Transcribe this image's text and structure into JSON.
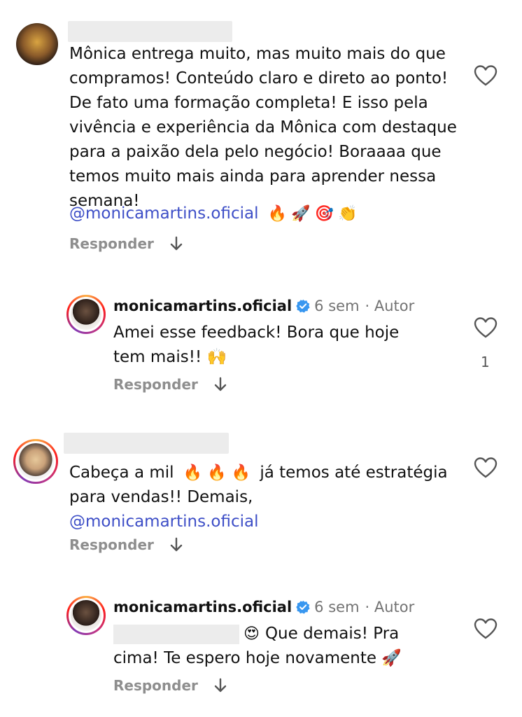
{
  "comments": [
    {
      "text": "Mônica entrega muito, mas muito mais do que compramos! Conteúdo claro e direto ao ponto! De fato uma formação completa! E isso pela vivência e experiência da Mônica com destaque para a paixão dela pelo negócio! Boraaaa que temos muito mais ainda para aprender nessa semana!",
      "mention": "@monicamartins.oficial",
      "emojis": "🔥🚀🎯👏",
      "reply_label": "Responder"
    },
    {
      "username": "monicamartins.oficial",
      "time": "6 sem",
      "author_label": "· Autor",
      "text": "Amei esse feedback! Bora que hoje tem mais!! 🙌",
      "like_count": "1",
      "reply_label": "Responder"
    },
    {
      "text_before": "Cabeça a mil",
      "emojis": "🔥 🔥 🔥",
      "text_after": "já temos até estratégia para vendas!! Demais,",
      "mention": "@monicamartins.oficial",
      "reply_label": "Responder"
    },
    {
      "username": "monicamartins.oficial",
      "time": "6 sem",
      "author_label": "· Autor",
      "emoji_start": "😍",
      "text": "Que demais! Pra cima! Te espero hoje novamente 🚀",
      "reply_label": "Responder"
    }
  ],
  "colors": {
    "mention": "#3e4fc7",
    "meta": "#737373",
    "verified": "#3897f0"
  },
  "icons": {
    "like": "heart-outline-icon",
    "reply_arrow": "down-arrow-icon",
    "verified": "verified-badge-icon"
  }
}
